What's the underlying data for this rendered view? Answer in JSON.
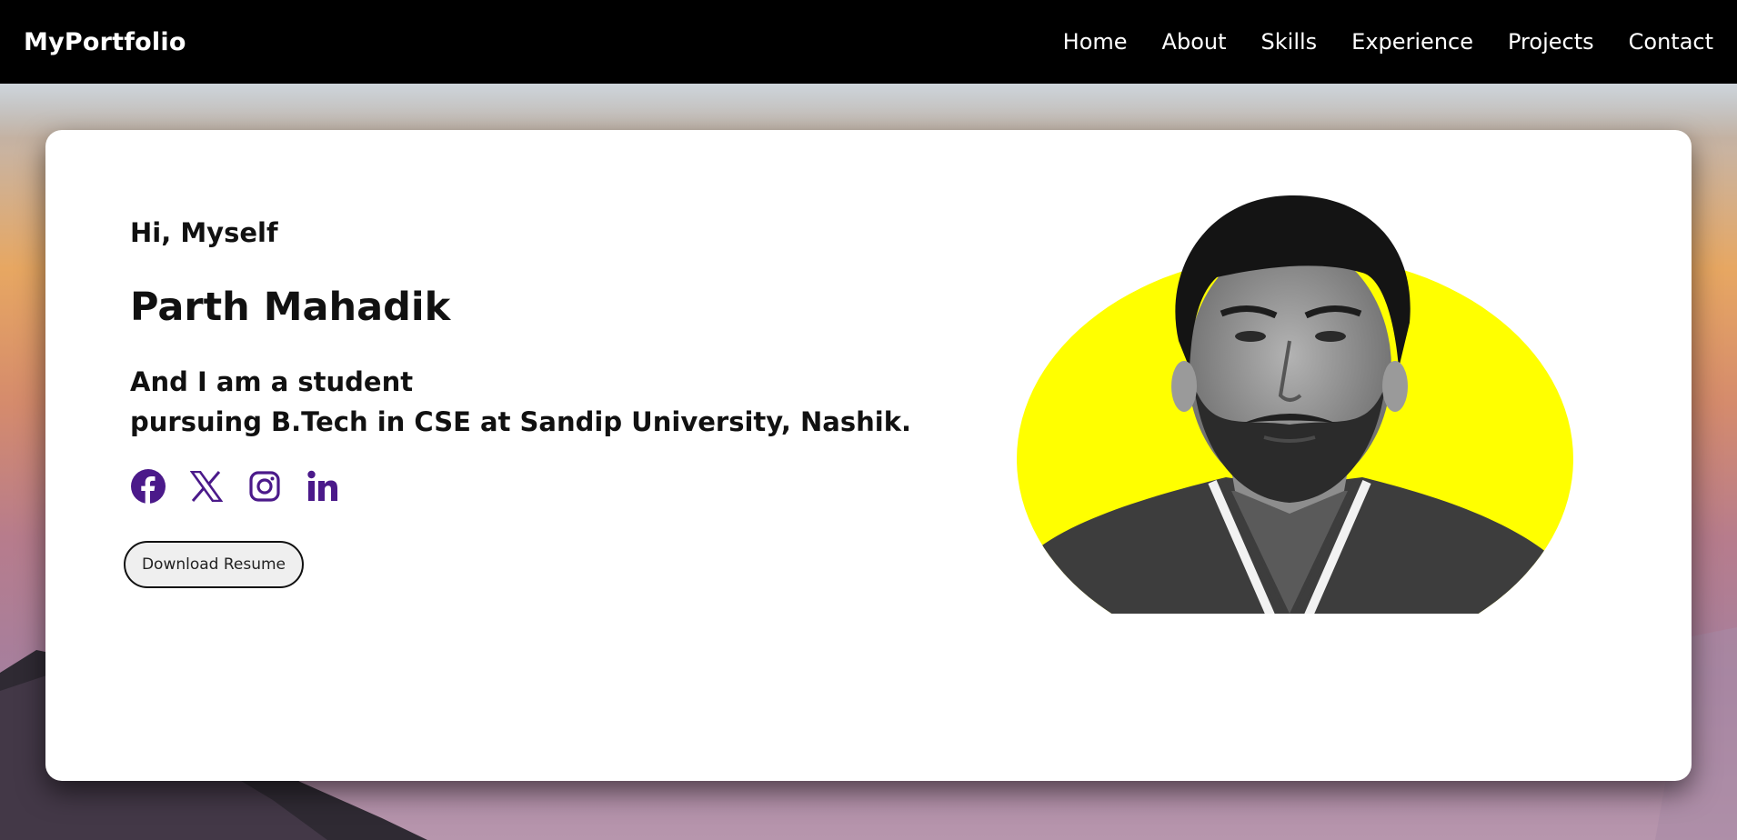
{
  "navbar": {
    "brand": "MyPortfolio",
    "links": [
      "Home",
      "About",
      "Skills",
      "Experience",
      "Projects",
      "Contact"
    ]
  },
  "hero": {
    "greeting": "Hi, Myself",
    "name": "Parth Mahadik",
    "description_line1": "And I am a student",
    "description_line2": "pursuing B.Tech in CSE at Sandip University, Nashik.",
    "social_icons": [
      "facebook-icon",
      "x-icon",
      "instagram-icon",
      "linkedin-icon"
    ],
    "resume_button": "Download Resume",
    "photo_backdrop_color": "#ffff00"
  },
  "colors": {
    "navbar_bg": "#000000",
    "icon_color": "#4b1a8a",
    "card_bg": "#ffffff"
  }
}
